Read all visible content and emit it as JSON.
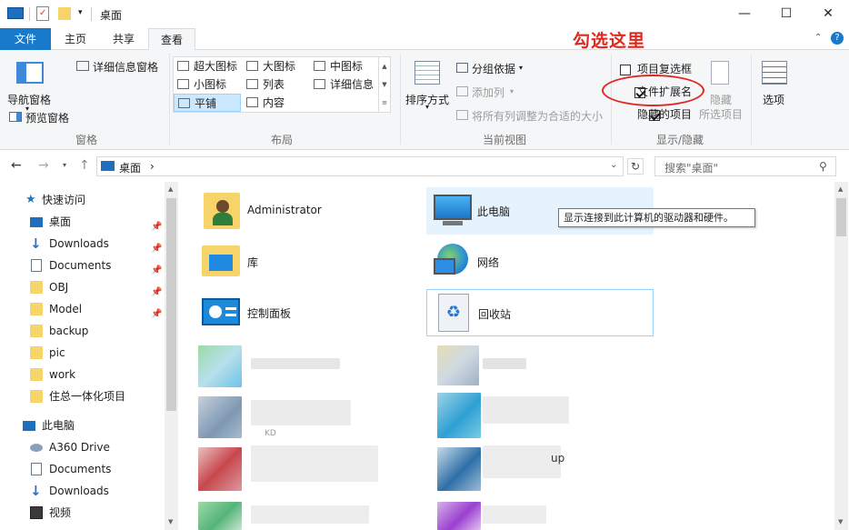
{
  "window": {
    "title": "桌面",
    "minimize": "—",
    "maximize": "☐",
    "close": "✕"
  },
  "tabs": {
    "file": "文件",
    "home": "主页",
    "share": "共享",
    "view": "查看"
  },
  "annotation": "勾选这里",
  "ribbon": {
    "panes": {
      "nav_pane": "导航窗格",
      "preview_pane": "预览窗格",
      "details_pane": "详细信息窗格",
      "group": "窗格"
    },
    "layout": {
      "items": [
        "超大图标",
        "大图标",
        "中图标",
        "小图标",
        "列表",
        "详细信息",
        "平铺",
        "内容"
      ],
      "group": "布局"
    },
    "current_view": {
      "sort": "排序方式",
      "group_by": "分组依据",
      "add_column": "添加列",
      "fit_columns": "将所有列调整为合适的大小",
      "group": "当前视图"
    },
    "show_hide": {
      "item_checkboxes": "项目复选框",
      "file_extensions": "文件扩展名",
      "hidden_items": "隐藏的项目",
      "hide_selected": "隐藏",
      "hide_selected_2": "所选项目",
      "group": "显示/隐藏"
    },
    "options": "选项"
  },
  "address": {
    "path": "桌面",
    "chevron": "›",
    "search_placeholder": "搜索\"桌面\""
  },
  "nav": {
    "quick_access": "快速访问",
    "items": [
      "桌面",
      "Downloads",
      "Documents",
      "OBJ",
      "Model",
      "backup",
      "pic",
      "work",
      "住总一体化项目"
    ],
    "this_pc": "此电脑",
    "pc_items": [
      "A360 Drive",
      "Documents",
      "Downloads",
      "视频"
    ]
  },
  "content": {
    "items": [
      "Administrator",
      "此电脑",
      "库",
      "网络",
      "控制面板",
      "回收站"
    ],
    "tooltip": "显示连接到此计算机的驱动器和硬件。",
    "fragment_1": "up",
    "fragment_2": "KD"
  },
  "colors": {
    "accent": "#1979ca",
    "annotation": "#e0281f",
    "ribbon_bg": "#f5f6f7",
    "selection": "#e5f3ff"
  }
}
